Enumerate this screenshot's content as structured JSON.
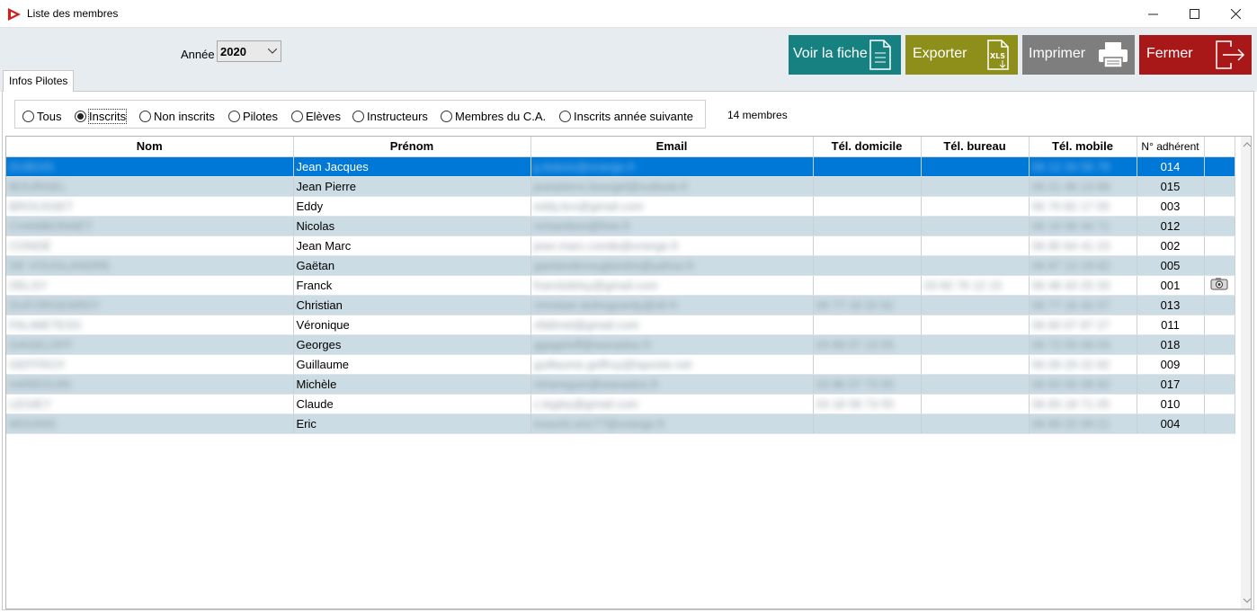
{
  "window": {
    "title": "Liste des membres",
    "app_icon": "app-logo-icon",
    "controls": [
      "minimize-icon",
      "maximize-icon",
      "close-icon"
    ]
  },
  "toolbar": {
    "year_label": "Année",
    "year_value": "2020",
    "buttons": {
      "voir": {
        "label": "Voir la fiche",
        "icon": "document-icon",
        "color": "#178080"
      },
      "exporter": {
        "label": "Exporter",
        "icon": "xls-export-icon",
        "color": "#8e8e1b"
      },
      "imprimer": {
        "label": "Imprimer",
        "icon": "printer-icon",
        "color": "#7e7e7e"
      },
      "fermer": {
        "label": "Fermer",
        "icon": "exit-icon",
        "color": "#a81818"
      }
    }
  },
  "tabs": [
    {
      "label": "Infos Pilotes",
      "active": true
    }
  ],
  "filters": {
    "options": [
      {
        "label": "Tous",
        "checked": false
      },
      {
        "label": "Inscrits",
        "checked": true
      },
      {
        "label": "Non inscrits",
        "checked": false
      },
      {
        "label": "Pilotes",
        "checked": false
      },
      {
        "label": "Elèves",
        "checked": false
      },
      {
        "label": "Instructeurs",
        "checked": false
      },
      {
        "label": "Membres du C.A.",
        "checked": false
      },
      {
        "label": "Inscrits année suivante",
        "checked": false
      }
    ],
    "count_text": "14 membres"
  },
  "table": {
    "columns": [
      "Nom",
      "Prénom",
      "Email",
      "Tél. domicile",
      "Tél. bureau",
      "Tél. mobile",
      "N° adhérent",
      ""
    ],
    "selected_row": 0,
    "rows": [
      {
        "nom": "DUBOIS",
        "prenom": "Jean Jacques",
        "email": "jj.dubois@orange.fr",
        "tel_domicile": "",
        "tel_bureau": "",
        "tel_mobile": "06 12 34 56 78",
        "adherent": "014",
        "photo": false
      },
      {
        "nom": "BOURGEL",
        "prenom": "Jean Pierre",
        "email": "jeanpierre.bourgel@outlook.fr",
        "tel_domicile": "",
        "tel_bureau": "",
        "tel_mobile": "06 21 46 13 89",
        "adherent": "015",
        "photo": false
      },
      {
        "nom": "BROUSSET",
        "prenom": "Eddy",
        "email": "eddy.bro@gmail.com",
        "tel_domicile": "",
        "tel_bureau": "",
        "tel_mobile": "06 70 82 17 55",
        "adherent": "003",
        "photo": false
      },
      {
        "nom": "CHAMBONNET",
        "prenom": "Nicolas",
        "email": "nchambon@free.fr",
        "tel_domicile": "",
        "tel_bureau": "",
        "tel_mobile": "06 19 58 44 71",
        "adherent": "012",
        "photo": false
      },
      {
        "nom": "CONDÉ",
        "prenom": "Jean Marc",
        "email": "jean.marc.conde@orange.fr",
        "tel_domicile": "",
        "tel_bureau": "",
        "tel_mobile": "06 80 64 41 23",
        "adherent": "002",
        "photo": false
      },
      {
        "nom": "DE VOUGLANDRE",
        "prenom": "Gaëtan",
        "email": "gaetandevouglandre@yahoo.fr",
        "tel_domicile": "",
        "tel_bureau": "",
        "tel_mobile": "06 87 13 19 62",
        "adherent": "005",
        "photo": false
      },
      {
        "nom": "DELSY",
        "prenom": "Franck",
        "email": "franckdelsy@gmail.com",
        "tel_domicile": "",
        "tel_bureau": "03 82 76 12 15",
        "tel_mobile": "06 48 43 25 33",
        "adherent": "001",
        "photo": true
      },
      {
        "nom": "DUFORGEARDY",
        "prenom": "Christian",
        "email": "christian.duforgeardy@sfr.fr",
        "tel_domicile": "09 77 18 22 91",
        "tel_bureau": "",
        "tel_mobile": "06 77 16 42 07",
        "adherent": "013",
        "photo": false
      },
      {
        "nom": "FALIMETESS",
        "prenom": "Véronique",
        "email": "vfalimet@gmail.com",
        "tel_domicile": "",
        "tel_bureau": "",
        "tel_mobile": "06 60 07 87 27",
        "adherent": "011",
        "photo": false
      },
      {
        "nom": "GAGELOFF",
        "prenom": "Georges",
        "email": "ggageloff@wanadoo.fr",
        "tel_domicile": "03 89 07 13 55",
        "tel_bureau": "",
        "tel_mobile": "06 72 05 09 03",
        "adherent": "018",
        "photo": false
      },
      {
        "nom": "GEFFROY",
        "prenom": "Guillaume",
        "email": "guillaume.geffroy@laposte.net",
        "tel_domicile": "",
        "tel_bureau": "",
        "tel_mobile": "06 09 29 22 92",
        "adherent": "009",
        "photo": false
      },
      {
        "nom": "HAREGUIN",
        "prenom": "Michèle",
        "email": "mhareguin@wanadoo.fr",
        "tel_domicile": "03 86 07 73 55",
        "tel_bureau": "",
        "tel_mobile": "06 83 00 08 82",
        "adherent": "017",
        "photo": false
      },
      {
        "nom": "LEGIEY",
        "prenom": "Claude",
        "email": "c.legiey@gmail.com",
        "tel_domicile": "03 18 58 73 55",
        "tel_bureau": "",
        "tel_mobile": "06 83 18 71 05",
        "adherent": "010",
        "photo": false
      },
      {
        "nom": "MOUNIS",
        "prenom": "Eric",
        "email": "mounis.eric77@orange.fr",
        "tel_domicile": "",
        "tel_bureau": "",
        "tel_mobile": "06 89 22 09 21",
        "adherent": "004",
        "photo": false
      }
    ]
  }
}
